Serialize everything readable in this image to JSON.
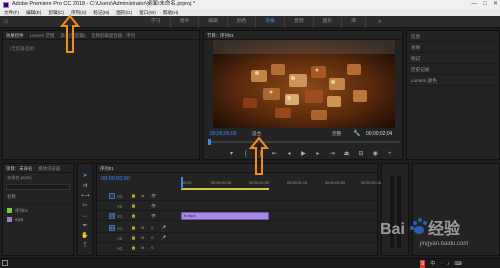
{
  "window": {
    "title": "Adobe Premiere Pro CC 2018 - C:\\Users\\Administrator\\桌面\\未命名.prproj *",
    "controls": [
      "—",
      "□",
      "✕"
    ]
  },
  "menu": [
    "文件(F)",
    "编辑(E)",
    "剪辑(C)",
    "序列(S)",
    "标记(M)",
    "图形(G)",
    "窗口(W)",
    "帮助(H)"
  ],
  "workspace": {
    "tabs": [
      "学习",
      "组件",
      "编辑",
      "颜色",
      "效果",
      "音频",
      "图形",
      "库"
    ],
    "active_tab": "效果",
    "more": "»"
  },
  "source_panel": {
    "tabs": [
      "效果控件",
      "Lumetri 范围",
      "源：(无剪辑)",
      "音频剪辑混合器：序列"
    ],
    "content": "（无剪辑选择）"
  },
  "program_monitor": {
    "tab": "节目：序列01",
    "timecode_current": "00;00;00;00",
    "zoom": "适合",
    "quality": "完整",
    "timecode_total": "00;00;02;04"
  },
  "effects_panel": {
    "items": [
      "信息",
      "效果",
      "标记",
      "历史记录",
      "Lumetri 颜色"
    ]
  },
  "project_panel": {
    "tabs": [
      "项目：未命名",
      "媒体浏览器"
    ],
    "file": "未命名.prproj",
    "column_name": "名称",
    "items": [
      {
        "name": "序列01",
        "color": "#7ac943"
      },
      {
        "name": "mp4",
        "color": "#9a7fd1"
      }
    ]
  },
  "timeline": {
    "tab": "序列01",
    "timecode": "00;00;00;00",
    "ruler": [
      "00;00",
      "00;00;00;15",
      "00;00;01;00",
      "00;00;01;15",
      "00;00;02;00",
      "00;00;02;15"
    ],
    "tracks": [
      "V3",
      "V2",
      "V1",
      "A1",
      "A2",
      "A3"
    ],
    "clip_label": "fx mp4",
    "clip_color": "#a88be0"
  },
  "watermark": {
    "text": "Baidu 经验",
    "sub": "jingyan.baidu.com"
  },
  "taskbar": {
    "items": [
      "S",
      "中",
      "·",
      "♪",
      "⌨"
    ]
  },
  "colors": {
    "accent_blue": "#3b8ae6",
    "annotation_orange": "#f28c1a"
  }
}
